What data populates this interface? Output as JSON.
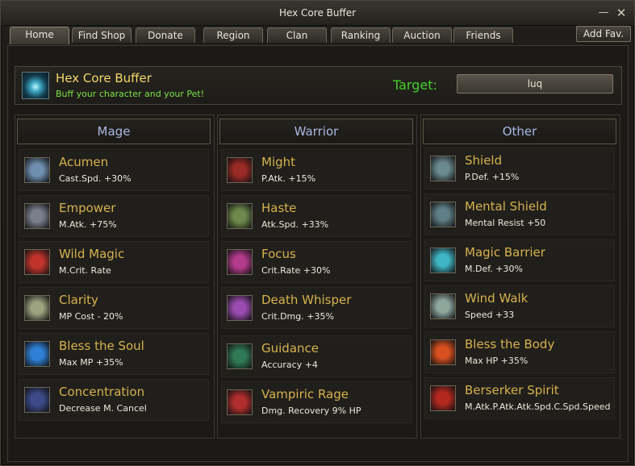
{
  "window": {
    "title": "Hex Core Buffer",
    "minimize_glyph": "—",
    "close_glyph": "✕"
  },
  "tabs": [
    {
      "label": "Home",
      "active": true
    },
    {
      "label": "Find Shop"
    },
    {
      "label": "Donate"
    },
    {
      "label": "Region"
    },
    {
      "label": "Clan"
    },
    {
      "label": "Ranking"
    },
    {
      "label": "Auction"
    },
    {
      "label": "Friends"
    }
  ],
  "add_fav_label": "Add Fav.",
  "header": {
    "title": "Hex Core Buffer",
    "subtitle": "Buff your character and your Pet!",
    "target_label": "Target:",
    "target_value": "luq"
  },
  "columns": [
    {
      "title": "Mage",
      "skills": [
        {
          "name": "Acumen",
          "desc": "Cast.Spd. +30%",
          "icon": "acumen-icon",
          "color": "#6f8fb0"
        },
        {
          "name": "Empower",
          "desc": "M.Atk. +75%",
          "icon": "empower-icon",
          "color": "#7a7f8c"
        },
        {
          "name": "Wild Magic",
          "desc": "M.Crit. Rate",
          "icon": "wild-magic-icon",
          "color": "#c0342b"
        },
        {
          "name": "Clarity",
          "desc": "MP Cost - 20%",
          "icon": "clarity-icon",
          "color": "#9da27f"
        },
        {
          "name": "Bless the Soul",
          "desc": "Max MP +35%",
          "icon": "bless-the-soul-icon",
          "color": "#2f7fd6"
        },
        {
          "name": "Concentration",
          "desc": "Decrease M. Cancel",
          "icon": "concentration-icon",
          "color": "#3c4a8a"
        }
      ]
    },
    {
      "title": "Warrior",
      "skills": [
        {
          "name": "Might",
          "desc": "P.Atk. +15%",
          "icon": "might-icon",
          "color": "#9a2a25"
        },
        {
          "name": "Haste",
          "desc": "Atk.Spd. +33%",
          "icon": "haste-icon",
          "color": "#6d8a4c"
        },
        {
          "name": "Focus",
          "desc": "Crit.Rate +30%",
          "icon": "focus-icon",
          "color": "#b43a8d"
        },
        {
          "name": "Death Whisper",
          "desc": "Crit.Dmg. +35%",
          "icon": "death-whisper-icon",
          "color": "#9b4bb0"
        },
        {
          "name": "Guidance",
          "desc": "Accuracy +4",
          "icon": "guidance-icon",
          "color": "#2f7a55"
        },
        {
          "name": "Vampiric Rage",
          "desc": "Dmg. Recovery 9% HP",
          "icon": "vampiric-rage-icon",
          "color": "#b22d2d"
        }
      ]
    },
    {
      "title": "Other",
      "skills": [
        {
          "name": "Shield",
          "desc": "P.Def. +15%",
          "icon": "shield-icon",
          "color": "#6a8a8f"
        },
        {
          "name": "Mental Shield",
          "desc": "Mental Resist +50",
          "icon": "mental-shield-icon",
          "color": "#5e7f86"
        },
        {
          "name": "Magic Barrier",
          "desc": "M.Def. +30%",
          "icon": "magic-barrier-icon",
          "color": "#3fb5c4"
        },
        {
          "name": "Wind Walk",
          "desc": "Speed +33",
          "icon": "wind-walk-icon",
          "color": "#8ea89e"
        },
        {
          "name": "Bless the Body",
          "desc": "Max HP +35%",
          "icon": "bless-the-body-icon",
          "color": "#d8501f"
        },
        {
          "name": "Berserker Spirit",
          "desc": "M.Atk.P.Atk.Atk.Spd.C.Spd.Speed",
          "icon": "berserker-spirit-icon",
          "color": "#b5281f"
        }
      ]
    }
  ]
}
